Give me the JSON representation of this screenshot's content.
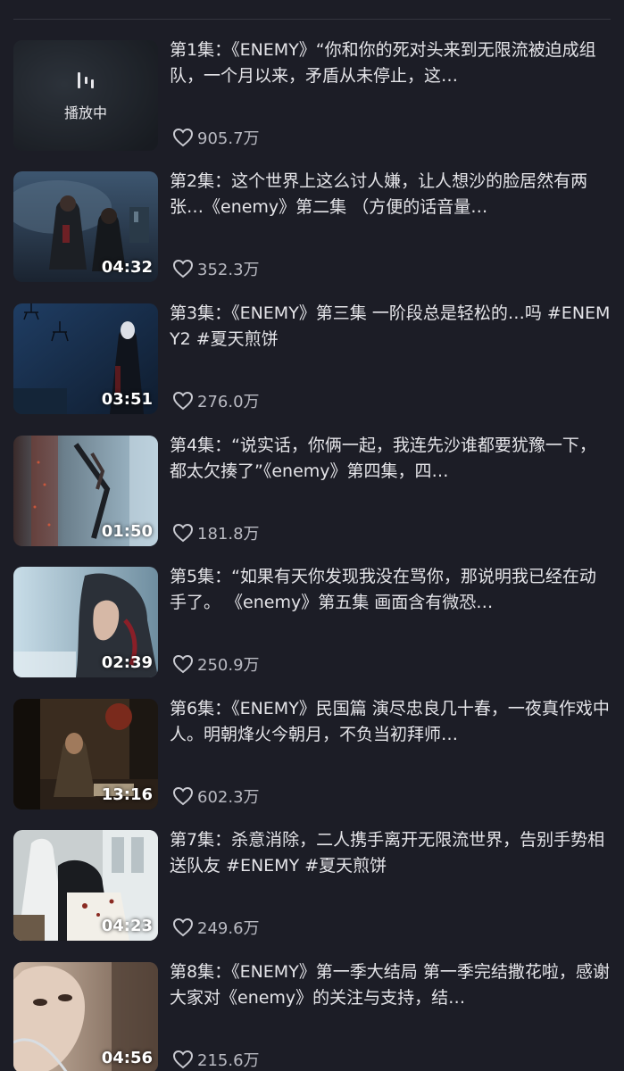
{
  "episodes": [
    {
      "title": "第1集：《ENEMY》“你和你的死对头来到无限流被迫成组队，一个月以来，矛盾从未停止，这…",
      "likes": "905.7万",
      "playing": true,
      "playing_label": "播放中",
      "duration": ""
    },
    {
      "title": "第2集：这个世界上这么讨人嫌，让人想沙的脸居然有两张…《enemy》第二集 （方便的话音量…",
      "likes": "352.3万",
      "duration": "04:32"
    },
    {
      "title": "第3集：《ENEMY》第三集 一阶段总是轻松的…吗 #ENEMY2 #夏天煎饼",
      "likes": "276.0万",
      "duration": "03:51"
    },
    {
      "title": "第4集：“说实话，你俩一起，我连先沙谁都要犹豫一下，都太欠揍了”《enemy》第四集，四…",
      "likes": "181.8万",
      "duration": "01:50"
    },
    {
      "title": "第5集：“如果有天你发现我没在骂你，那说明我已经在动手了。 《enemy》第五集 画面含有微恐…",
      "likes": "250.9万",
      "duration": "02:39"
    },
    {
      "title": "第6集：《ENEMY》民国篇 演尽忠良几十春，一夜真作戏中人。明朝烽火今朝月，不负当初拜师…",
      "likes": "602.3万",
      "duration": "13:16"
    },
    {
      "title": "第7集：杀意消除，二人携手离开无限流世界，告别手势相送队友 #ENEMY #夏天煎饼",
      "likes": "249.6万",
      "duration": "04:23"
    },
    {
      "title": "第8集：《ENEMY》第一季大结局 第一季完结撒花啦，感谢大家对《enemy》的关注与支持，结…",
      "likes": "215.6万",
      "duration": "04:56"
    }
  ],
  "icons": {
    "like": "heart-outline-icon",
    "playing": "sound-bars-icon"
  },
  "colors": {
    "background": "#1c1d26",
    "text": "#e4e4e8",
    "muted": "#b9bac2"
  }
}
